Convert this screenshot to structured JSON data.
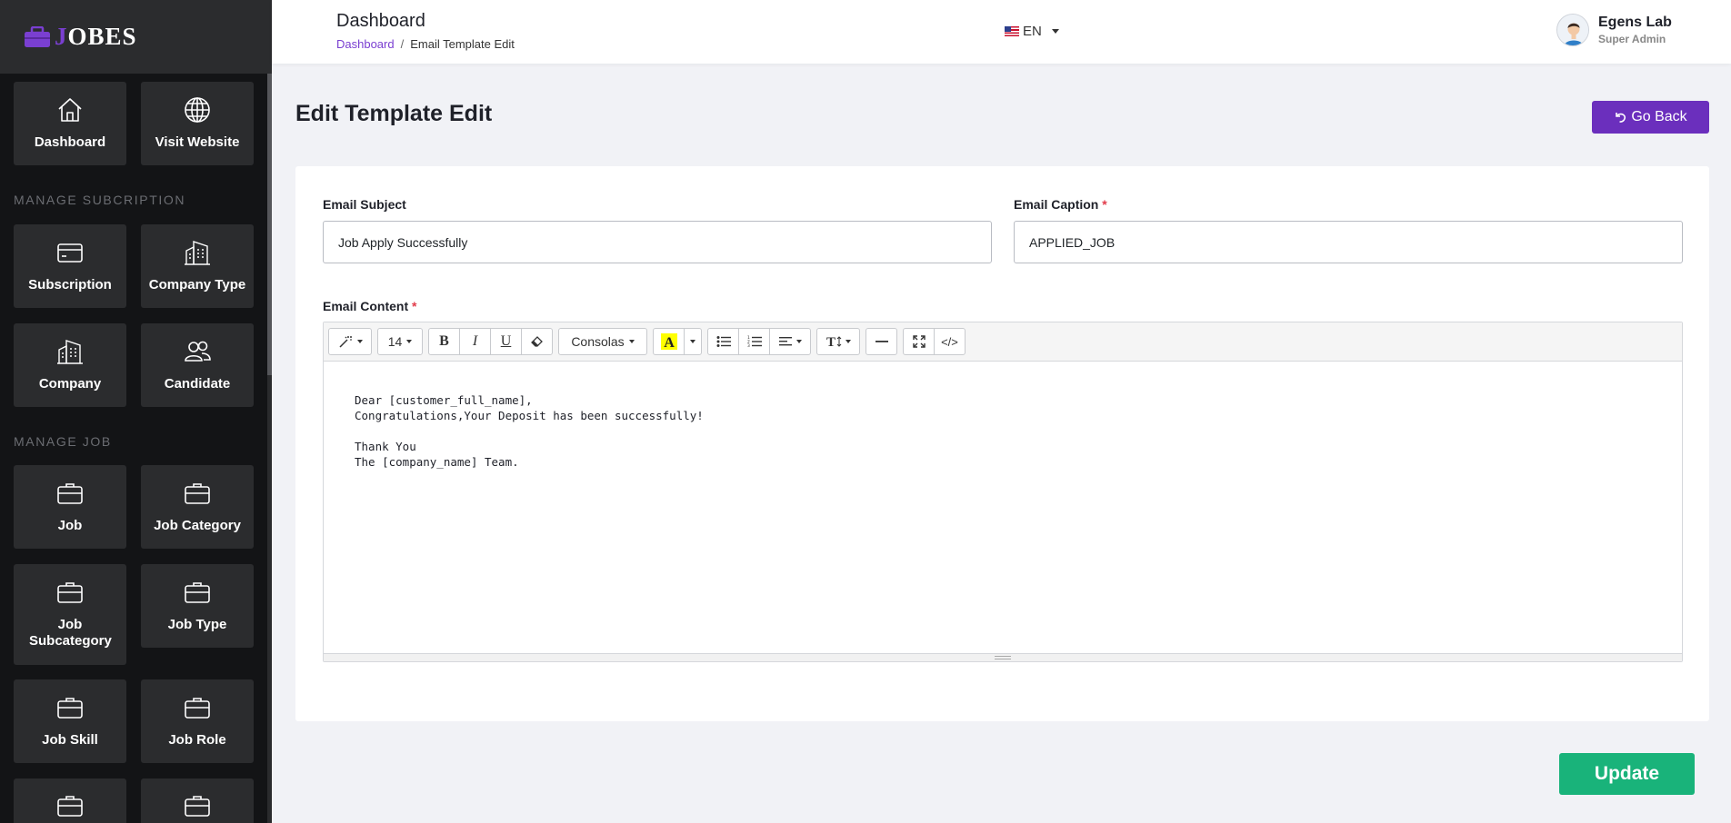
{
  "brand": {
    "first_letter": "J",
    "rest": "OBES"
  },
  "sidebar": {
    "top_tiles": [
      {
        "label": "Dashboard",
        "icon": "home-icon"
      },
      {
        "label": "Visit Website",
        "icon": "globe-icon"
      }
    ],
    "sections": [
      {
        "title": "MANAGE SUBCRIPTION",
        "items": [
          "Subscription",
          "Company Type",
          "Company",
          "Candidate"
        ]
      },
      {
        "title": "MANAGE JOB",
        "items": [
          "Job",
          "Job Category",
          "Job Subcategory",
          "Job Type",
          "Job Skill",
          "Job Role"
        ]
      }
    ]
  },
  "header": {
    "title": "Dashboard",
    "breadcrumb": {
      "home": "Dashboard",
      "current": "Email Template Edit",
      "separator": "/"
    },
    "language": "EN",
    "user": {
      "name": "Egens Lab",
      "role": "Super Admin"
    }
  },
  "main": {
    "heading": "Edit Template Edit",
    "back_button": "Go Back",
    "email_subject": {
      "label": "Email Subject",
      "value": "Job Apply Successfully"
    },
    "email_caption": {
      "label": "Email Caption",
      "required_mark": "*",
      "value": "APPLIED_JOB"
    },
    "email_content": {
      "label": "Email Content",
      "required_mark": "*",
      "toolbar": {
        "font_size": "14",
        "font_family": "Consolas",
        "bold": "B",
        "italic": "I",
        "underline": "U",
        "code": "</>"
      },
      "body": "Dear [customer_full_name],\nCongratulations,Your Deposit has been successfully!\n\nThank You\nThe [company_name] Team."
    },
    "update_button": "Update"
  },
  "colors": {
    "accent": "#6b2fbd",
    "success": "#19b37a",
    "sidebar_bg": "#131416",
    "tile_bg": "#2b2c2e"
  }
}
